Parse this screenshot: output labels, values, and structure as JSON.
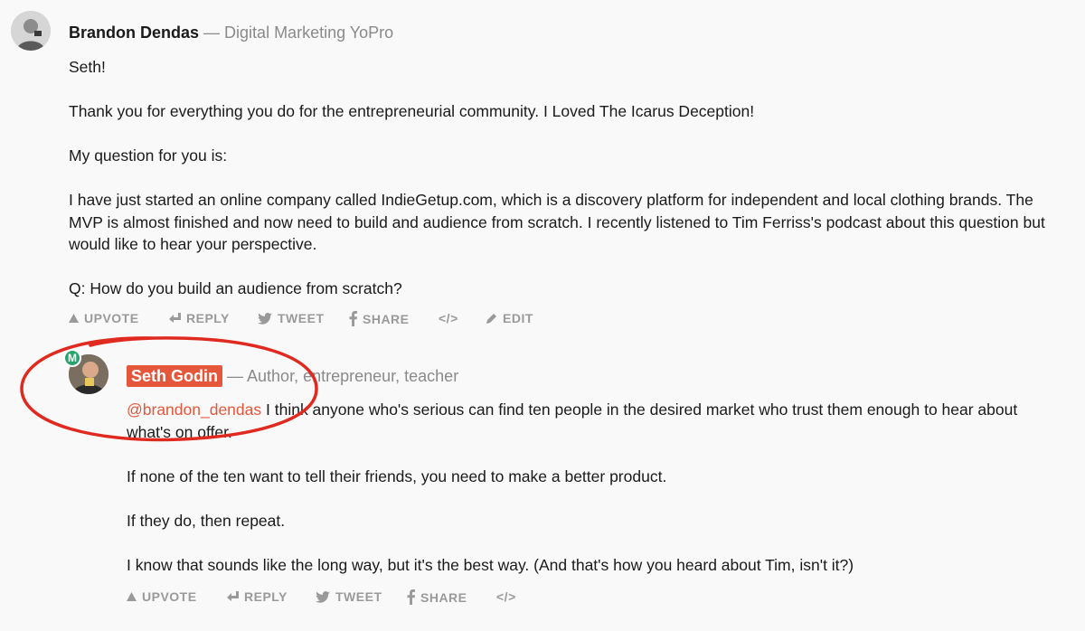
{
  "comment": {
    "author": "Brandon Dendas",
    "title": "— Digital Marketing YoPro",
    "paragraphs": [
      "Seth!",
      "Thank you for everything you do for the entrepreneurial community. I Loved The Icarus Deception!",
      "My question for you is:",
      "I have just started an online company called IndieGetup.com, which is a discovery platform for independent and local clothing brands. The MVP is almost finished and now need to build and audience from scratch. I recently listened to Tim Ferriss's podcast about this question but would like to hear your perspective.",
      "Q: How do you build an audience from scratch?"
    ],
    "actions": {
      "upvote": "UPVOTE",
      "reply": "REPLY",
      "tweet": "TWEET",
      "share": "SHARE",
      "embed": "</>",
      "edit": "EDIT"
    }
  },
  "reply": {
    "badge": "M",
    "author": "Seth Godin",
    "title": "— Author, entrepreneur, teacher",
    "mention": "@brandon_dendas",
    "first_paragraph_rest": " I think anyone who's serious can find ten people in the desired market who trust them enough to hear about what's on offer.",
    "paragraphs": [
      "If none of the ten want to tell their friends, you need to make a better product.",
      "If they do, then repeat.",
      "I know that sounds like the long way, but it's the best way. (And that's how you heard about Tim, isn't it?)"
    ],
    "actions": {
      "upvote": "UPVOTE",
      "reply": "REPLY",
      "tweet": "TWEET",
      "share": "SHARE",
      "embed": "</>"
    }
  },
  "colors": {
    "highlight": "#e6563a",
    "annotation_circle": "#e02a20",
    "maker_badge": "#2aa26e"
  }
}
